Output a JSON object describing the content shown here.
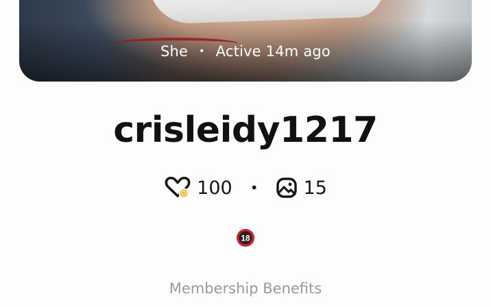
{
  "profile": {
    "pronoun": "She",
    "separator": "•",
    "active_status": "Active 14m ago",
    "username": "crisleidy1217"
  },
  "stats": {
    "likes_count": "100",
    "likes_icon": "heart-coin-icon",
    "separator": "•",
    "media_count": "15",
    "media_icon": "image-icon"
  },
  "badges": {
    "age_badge_text": "18",
    "age_badge_icon": "adult-18-icon",
    "age_badge_color": "#c9232f"
  },
  "sections": {
    "membership_label": "Membership Benefits"
  },
  "colors": {
    "text_primary": "#111111",
    "text_muted": "#9a9a9a",
    "coin_accent": "#f2b631"
  }
}
